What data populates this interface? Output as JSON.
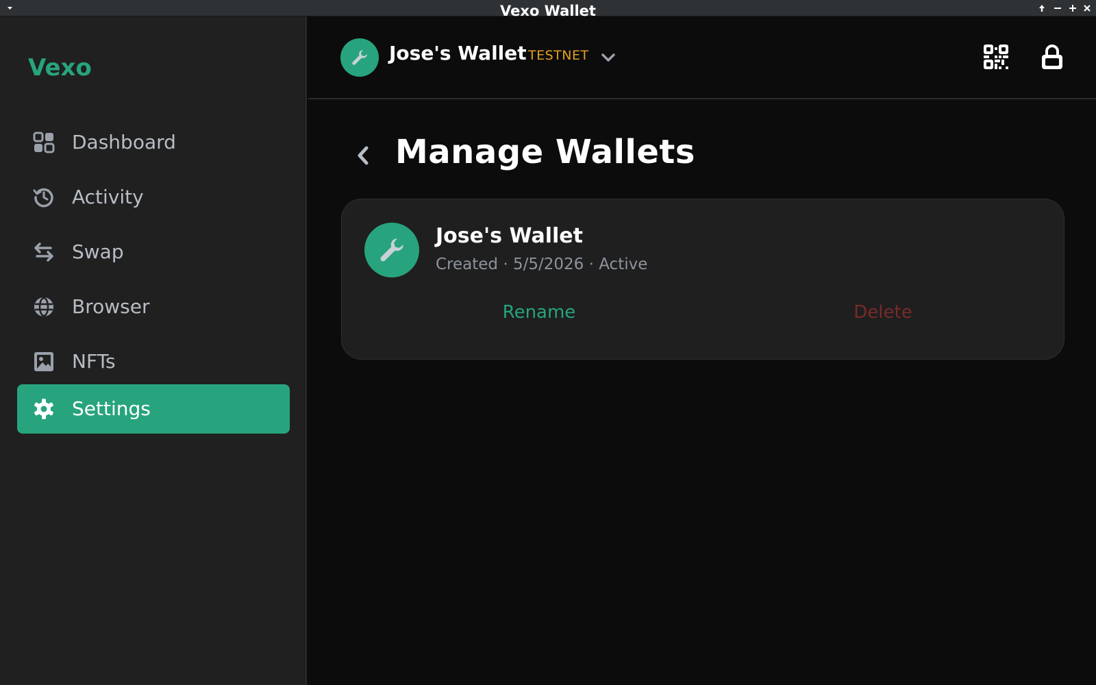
{
  "window": {
    "title": "Vexo Wallet"
  },
  "sidebar": {
    "brand": "Vexo",
    "items": [
      {
        "label": "Dashboard",
        "icon": "dashboard-icon",
        "active": false
      },
      {
        "label": "Activity",
        "icon": "history-icon",
        "active": false
      },
      {
        "label": "Swap",
        "icon": "swap-arrows-icon",
        "active": false
      },
      {
        "label": "Browser",
        "icon": "globe-icon",
        "active": false
      },
      {
        "label": "NFTs",
        "icon": "image-icon",
        "active": false
      },
      {
        "label": "Settings",
        "icon": "gear-icon",
        "active": true
      }
    ]
  },
  "header": {
    "wallet_name": "Jose's Wallet",
    "network": "TESTNET",
    "avatar_icon": "wrench-icon"
  },
  "page": {
    "title": "Manage Wallets"
  },
  "wallet_card": {
    "name": "Jose's Wallet",
    "created_label": "Created",
    "separator": "·",
    "created_date": "5/5/2026",
    "status": "Active",
    "rename_label": "Rename",
    "delete_label": "Delete"
  },
  "colors": {
    "accent": "#27a47e",
    "testnet": "#e5a01b",
    "danger": "#7a2a2a",
    "sidebar_bg": "#202020",
    "main_bg": "#0c0c0c"
  }
}
